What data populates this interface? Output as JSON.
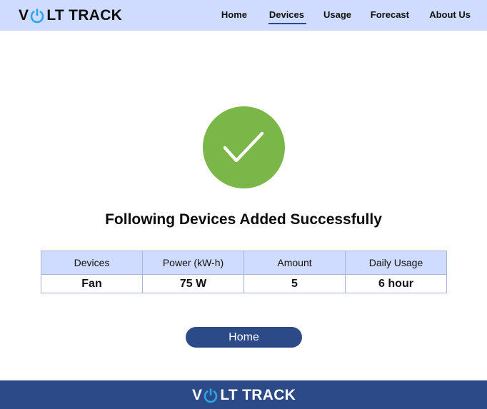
{
  "header": {
    "logo_left": "V",
    "logo_right": "LT TRACK",
    "nav": [
      {
        "label": "Home"
      },
      {
        "label": "Devices"
      },
      {
        "label": "Usage"
      },
      {
        "label": "Forecast"
      },
      {
        "label": "About Us"
      }
    ],
    "active_nav": "Devices"
  },
  "main": {
    "status_icon": "checkmark-icon",
    "headline": "Following Devices Added Successfully",
    "table": {
      "columns": [
        "Devices",
        "Power (kW-h)",
        "Amount",
        "Daily Usage"
      ],
      "rows": [
        [
          "Fan",
          "75 W",
          "5",
          "6 hour"
        ]
      ]
    },
    "home_button": "Home"
  },
  "footer": {
    "logo_left": "V",
    "logo_right": "LT TRACK"
  },
  "colors": {
    "header_bg": "#cfdcff",
    "brand_blue": "#2d4a88",
    "power_icon_blue": "#29a6e8",
    "success_green": "#7ab648"
  }
}
